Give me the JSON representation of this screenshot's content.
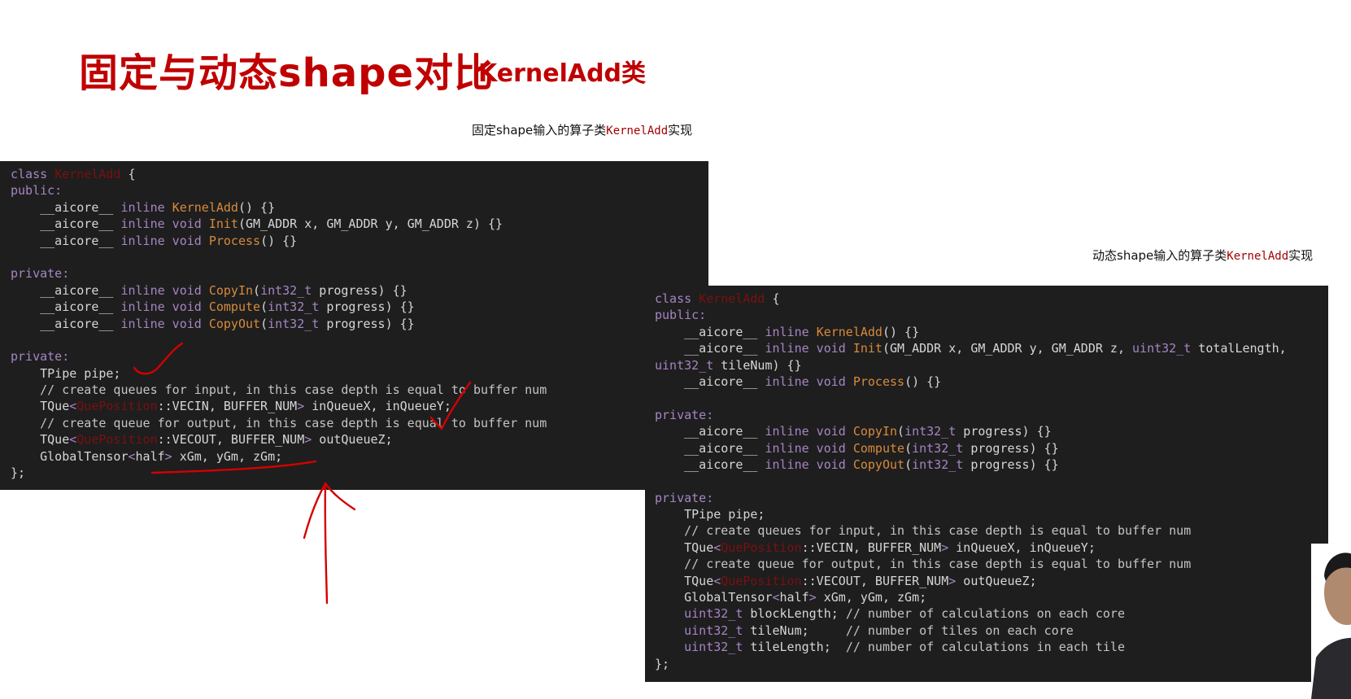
{
  "slide": {
    "title": "固定与动态shape对比",
    "subtitle": "KernelAdd类",
    "caption_fixed": {
      "prefix": "固定shape输入的算子类",
      "class": "KernelAdd",
      "suffix": "实现"
    },
    "caption_dynamic": {
      "prefix": "动态shape输入的算子类",
      "class": "KernelAdd",
      "suffix": "实现"
    }
  },
  "code_fixed": [
    [
      [
        "kw",
        "class "
      ],
      [
        "cls",
        "KernelAdd"
      ],
      [
        "t",
        " {"
      ]
    ],
    [
      [
        "kw",
        "public:"
      ]
    ],
    [
      [
        "t",
        "    __aicore__ "
      ],
      [
        "kw",
        "inline "
      ],
      [
        "fn",
        "KernelAdd"
      ],
      [
        "t",
        "() {}"
      ]
    ],
    [
      [
        "t",
        "    __aicore__ "
      ],
      [
        "kw",
        "inline void "
      ],
      [
        "fn",
        "Init"
      ],
      [
        "t",
        "(GM_ADDR x, GM_ADDR y, GM_ADDR z) {}"
      ]
    ],
    [
      [
        "t",
        "    __aicore__ "
      ],
      [
        "kw",
        "inline void "
      ],
      [
        "fn",
        "Process"
      ],
      [
        "t",
        "() {}"
      ]
    ],
    [],
    [
      [
        "kw",
        "private:"
      ]
    ],
    [
      [
        "t",
        "    __aicore__ "
      ],
      [
        "kw",
        "inline void "
      ],
      [
        "fn",
        "CopyIn"
      ],
      [
        "t",
        "("
      ],
      [
        "kw",
        "int32_t"
      ],
      [
        "t",
        " progress) {}"
      ]
    ],
    [
      [
        "t",
        "    __aicore__ "
      ],
      [
        "kw",
        "inline void "
      ],
      [
        "fn",
        "Compute"
      ],
      [
        "t",
        "("
      ],
      [
        "kw",
        "int32_t"
      ],
      [
        "t",
        " progress) {}"
      ]
    ],
    [
      [
        "t",
        "    __aicore__ "
      ],
      [
        "kw",
        "inline void "
      ],
      [
        "fn",
        "CopyOut"
      ],
      [
        "t",
        "("
      ],
      [
        "kw",
        "int32_t"
      ],
      [
        "t",
        " progress) {}"
      ]
    ],
    [],
    [
      [
        "kw",
        "private:"
      ]
    ],
    [
      [
        "t",
        "    TPipe pipe;"
      ]
    ],
    [
      [
        "cm",
        "    // create queues for input, in this case depth is equal to buffer num"
      ]
    ],
    [
      [
        "t",
        "    TQue"
      ],
      [
        "kw",
        "<"
      ],
      [
        "cls",
        "QuePosition"
      ],
      [
        "t",
        "::VECIN, BUFFER_NUM"
      ],
      [
        "kw",
        ">"
      ],
      [
        "t",
        " inQueueX, inQueueY;"
      ]
    ],
    [
      [
        "cm",
        "    // create queue for output, in this case depth is equal to buffer num"
      ]
    ],
    [
      [
        "t",
        "    TQue"
      ],
      [
        "kw",
        "<"
      ],
      [
        "cls",
        "QuePosition"
      ],
      [
        "t",
        "::VECOUT, BUFFER_NUM"
      ],
      [
        "kw",
        ">"
      ],
      [
        "t",
        " outQueueZ;"
      ]
    ],
    [
      [
        "t",
        "    GlobalTensor"
      ],
      [
        "kw",
        "<"
      ],
      [
        "t",
        "half"
      ],
      [
        "kw",
        ">"
      ],
      [
        "t",
        " xGm, yGm, zGm;"
      ]
    ],
    [
      [
        "t",
        "};"
      ]
    ]
  ],
  "code_dynamic": [
    [
      [
        "kw",
        "class "
      ],
      [
        "cls",
        "KernelAdd"
      ],
      [
        "t",
        " {"
      ]
    ],
    [
      [
        "kw",
        "public:"
      ]
    ],
    [
      [
        "t",
        "    __aicore__ "
      ],
      [
        "kw",
        "inline "
      ],
      [
        "fn",
        "KernelAdd"
      ],
      [
        "t",
        "() {}"
      ]
    ],
    [
      [
        "t",
        "    __aicore__ "
      ],
      [
        "kw",
        "inline void "
      ],
      [
        "fn",
        "Init"
      ],
      [
        "t",
        "(GM_ADDR x, GM_ADDR y, GM_ADDR z, "
      ],
      [
        "kw",
        "uint32_t"
      ],
      [
        "t",
        " totalLength,"
      ]
    ],
    [
      [
        "kw",
        "uint32_t"
      ],
      [
        "t",
        " tileNum) {}"
      ]
    ],
    [
      [
        "t",
        "    __aicore__ "
      ],
      [
        "kw",
        "inline void "
      ],
      [
        "fn",
        "Process"
      ],
      [
        "t",
        "() {}"
      ]
    ],
    [],
    [
      [
        "kw",
        "private:"
      ]
    ],
    [
      [
        "t",
        "    __aicore__ "
      ],
      [
        "kw",
        "inline void "
      ],
      [
        "fn",
        "CopyIn"
      ],
      [
        "t",
        "("
      ],
      [
        "kw",
        "int32_t"
      ],
      [
        "t",
        " progress) {}"
      ]
    ],
    [
      [
        "t",
        "    __aicore__ "
      ],
      [
        "kw",
        "inline void "
      ],
      [
        "fn",
        "Compute"
      ],
      [
        "t",
        "("
      ],
      [
        "kw",
        "int32_t"
      ],
      [
        "t",
        " progress) {}"
      ]
    ],
    [
      [
        "t",
        "    __aicore__ "
      ],
      [
        "kw",
        "inline void "
      ],
      [
        "fn",
        "CopyOut"
      ],
      [
        "t",
        "("
      ],
      [
        "kw",
        "int32_t"
      ],
      [
        "t",
        " progress) {}"
      ]
    ],
    [],
    [
      [
        "kw",
        "private:"
      ]
    ],
    [
      [
        "t",
        "    TPipe pipe;"
      ]
    ],
    [
      [
        "cm",
        "    // create queues for input, in this case depth is equal to buffer num"
      ]
    ],
    [
      [
        "t",
        "    TQue"
      ],
      [
        "kw",
        "<"
      ],
      [
        "cls",
        "QuePosition"
      ],
      [
        "t",
        "::VECIN, BUFFER_NUM"
      ],
      [
        "kw",
        ">"
      ],
      [
        "t",
        " inQueueX, inQueueY;"
      ]
    ],
    [
      [
        "cm",
        "    // create queue for output, in this case depth is equal to buffer num"
      ]
    ],
    [
      [
        "t",
        "    TQue"
      ],
      [
        "kw",
        "<"
      ],
      [
        "cls",
        "QuePosition"
      ],
      [
        "t",
        "::VECOUT, BUFFER_NUM"
      ],
      [
        "kw",
        ">"
      ],
      [
        "t",
        " outQueueZ;"
      ]
    ],
    [
      [
        "t",
        "    GlobalTensor"
      ],
      [
        "kw",
        "<"
      ],
      [
        "t",
        "half"
      ],
      [
        "kw",
        ">"
      ],
      [
        "t",
        " xGm, yGm, zGm;"
      ]
    ],
    [
      [
        "kw",
        "    uint32_t"
      ],
      [
        "t",
        " blockLength; "
      ],
      [
        "cm",
        "// number of calculations on each core"
      ]
    ],
    [
      [
        "kw",
        "    uint32_t"
      ],
      [
        "t",
        " tileNum;     "
      ],
      [
        "cm",
        "// number of tiles on each core"
      ]
    ],
    [
      [
        "kw",
        "    uint32_t"
      ],
      [
        "t",
        " tileLength;  "
      ],
      [
        "cm",
        "// number of calculations in each tile"
      ]
    ],
    [
      [
        "t",
        "};"
      ]
    ]
  ],
  "colors": {
    "title": "#c00000",
    "code_bg": "#1e1e1e",
    "keyword": "#a685c4",
    "function": "#d88a3c",
    "class": "#7a1010",
    "annotation": "#d40000"
  }
}
